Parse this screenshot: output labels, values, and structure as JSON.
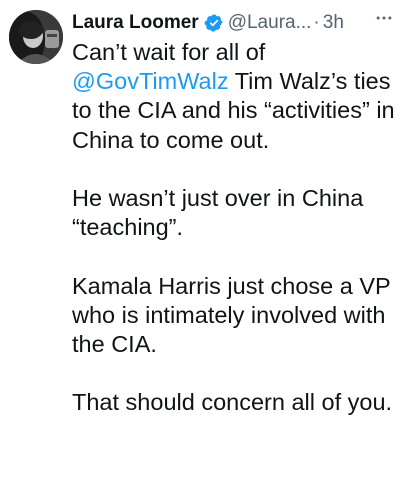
{
  "author": {
    "name": "Laura Loomer",
    "handle": "@Laura...",
    "separator": "·",
    "time": "3h",
    "avatar_icon": "profile-photo",
    "verified_icon": "verified-badge-icon",
    "verified_color": "#1d9bf0"
  },
  "tweet": {
    "para1_start": "Can’t wait for all of ",
    "para1_mention": "@GovTimWalz",
    "para1_end": " Tim Walz’s ties to the CIA and his “activities” in China to come out.",
    "para2": "He wasn’t just over in China “teaching”.",
    "para3": "Kamala Harris just chose a VP who is intimately involved with the CIA.",
    "para4": "That should concern all of you."
  },
  "colors": {
    "text": "#0f1419",
    "secondary": "#536471",
    "link": "#1d9bf0"
  },
  "icons": {
    "more": "more-horizontal-icon"
  }
}
